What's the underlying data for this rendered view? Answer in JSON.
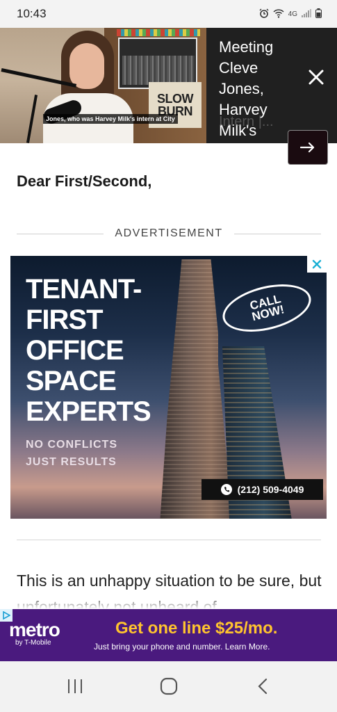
{
  "status_bar": {
    "time": "10:43",
    "network_label": "4G"
  },
  "video": {
    "caption": "Jones, who was Harvey Milk's intern at City",
    "book_sign_line1": "SLOW",
    "book_sign_line2": "BURN",
    "title": "Meeting Cleve Jones, Harvey Milk's",
    "title_fade": "Intern |..."
  },
  "article": {
    "greeting": "Dear First/Second,",
    "ad_label": "ADVERTISEMENT",
    "body_text": "This is an unhappy situation to be sure, but unfortunately not unheard of"
  },
  "ad": {
    "headline": "TENANT-\nFIRST\nOFFICE\nSPACE\nEXPERTS",
    "sub": "NO CONFLICTS\nJUST RESULTS",
    "call": "CALL\nNOW!",
    "phone": "(212) 509-4049"
  },
  "metro": {
    "logo": "metro",
    "by": "by T-Mobile",
    "headline": "Get one line $25/mo.",
    "sub": "Just bring your phone and number. Learn More."
  },
  "colors": {
    "metro_purple": "#4a1a7e",
    "metro_yellow": "#ffc42e",
    "video_bg": "#202020"
  }
}
